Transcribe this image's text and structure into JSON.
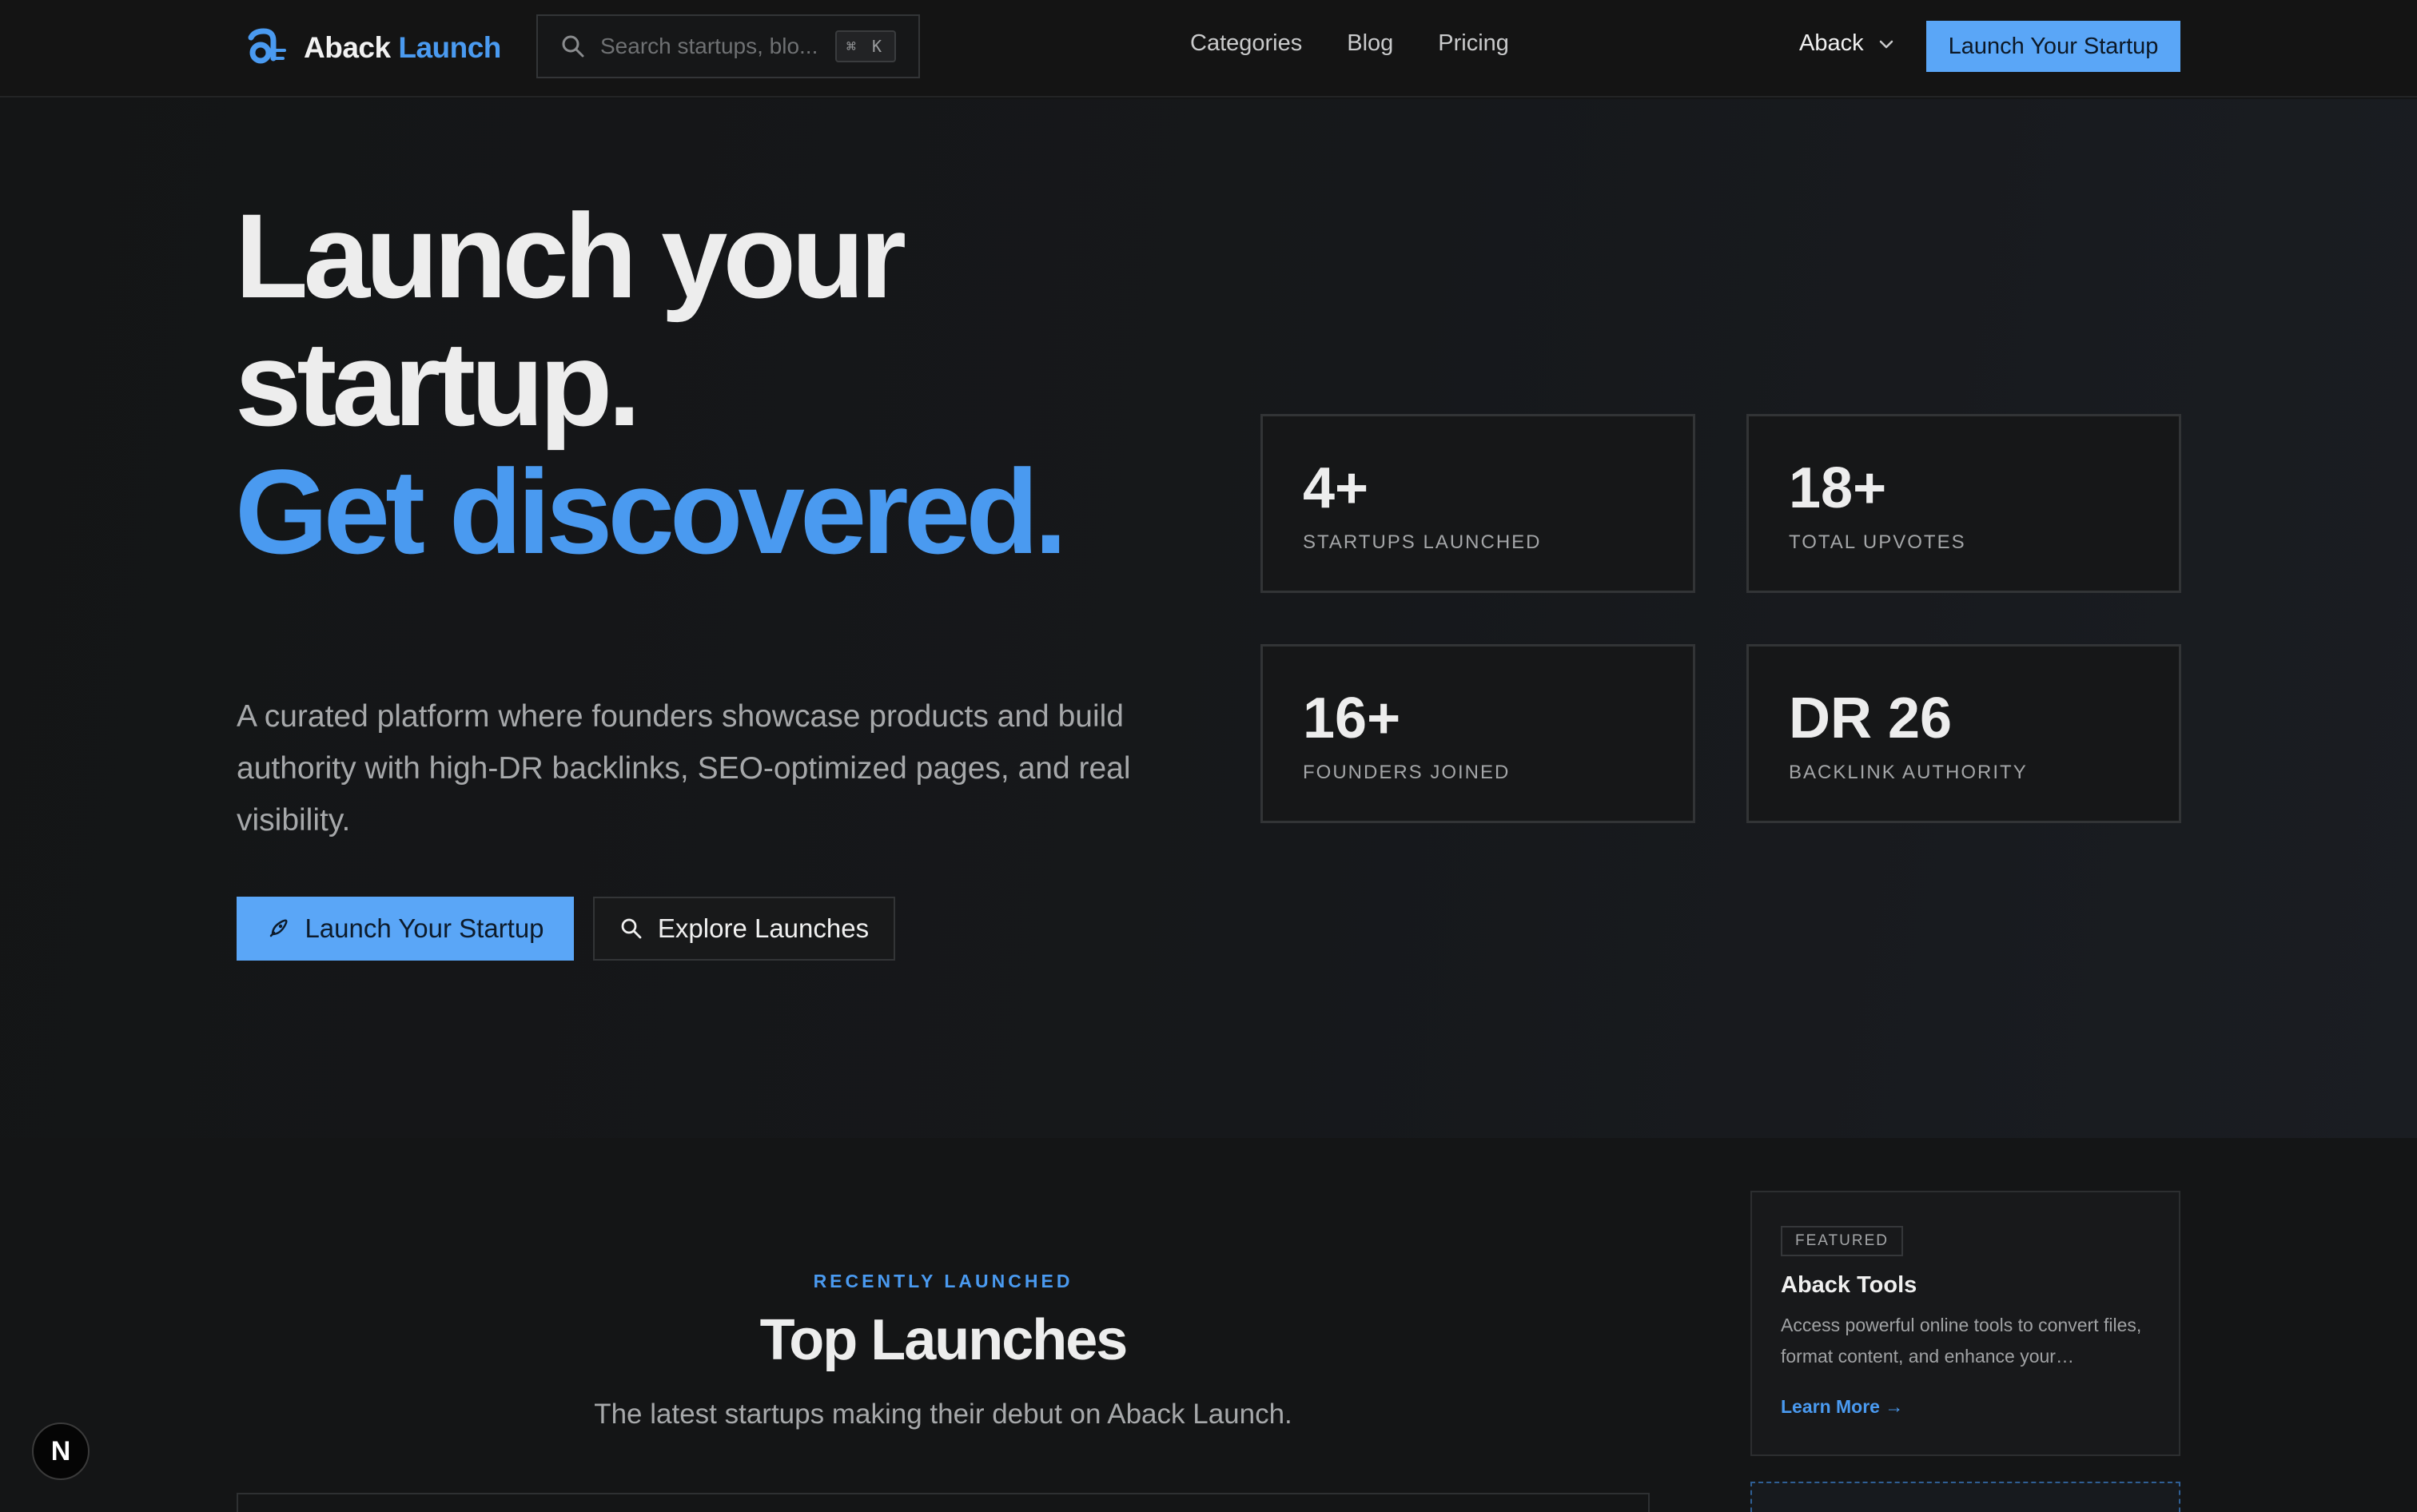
{
  "header": {
    "logo_word1": "Aback",
    "logo_word2": "Launch",
    "search_placeholder": "Search startups, blo...",
    "search_shortcut": "⌘ K",
    "nav": [
      "Categories",
      "Blog",
      "Pricing"
    ],
    "account_label": "Aback",
    "cta_label": "Launch Your Startup"
  },
  "hero": {
    "title_line1": "Launch your",
    "title_line2": "startup.",
    "title_line3": "Get discovered.",
    "description": "A curated platform where founders showcase products and build authority with high-DR backlinks, SEO-optimized pages, and real visibility.",
    "primary_button": "Launch Your Startup",
    "secondary_button": "Explore Launches",
    "stats": [
      {
        "value": "4+",
        "label": "STARTUPS LAUNCHED"
      },
      {
        "value": "18+",
        "label": "TOTAL UPVOTES"
      },
      {
        "value": "16+",
        "label": "FOUNDERS JOINED"
      },
      {
        "value": "DR 26",
        "label": "BACKLINK AUTHORITY"
      }
    ]
  },
  "recent": {
    "eyebrow": "RECENTLY LAUNCHED",
    "title": "Top Launches",
    "subtitle": "The latest startups making their debut on Aback Launch."
  },
  "featured": {
    "badge": "FEATURED",
    "title": "Aback Tools",
    "description": "Access powerful online tools to convert files, format content, and enhance your…",
    "link": "Learn More →"
  },
  "dev_badge": "N",
  "colors": {
    "accent": "#4a9af0",
    "cta_background": "#5aa6f7",
    "page_background": "#141516"
  },
  "icons": {
    "logo": "aback-logo-icon",
    "search": "search-icon",
    "dropdown": "chevron-down-icon",
    "rocket": "rocket-icon"
  }
}
